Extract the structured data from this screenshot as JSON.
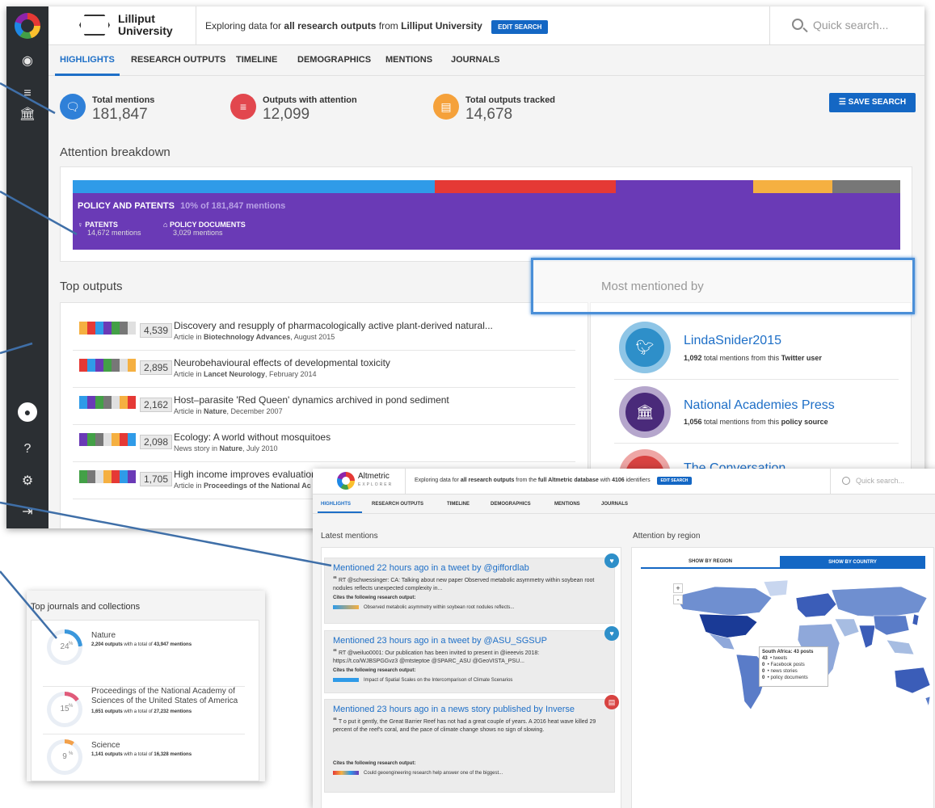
{
  "main": {
    "institution_line1": "Lilliput",
    "institution_line2": "University",
    "explore_pre": "Exploring data for ",
    "explore_bold1": "all research outputs",
    "explore_mid": " from ",
    "explore_bold2": "Lilliput University",
    "edit_search": "EDIT SEARCH",
    "quick_search_placeholder": "Quick search...",
    "tabs": [
      "HIGHLIGHTS",
      "RESEARCH OUTPUTS",
      "TIMELINE",
      "DEMOGRAPHICS",
      "MENTIONS",
      "JOURNALS"
    ],
    "stats": [
      {
        "label": "Total mentions",
        "value": "181,847",
        "color": "#2f80d8",
        "icon": "speech-bubbles-icon"
      },
      {
        "label": "Outputs with attention",
        "value": "12,099",
        "color": "#e2474e",
        "icon": "chat-icon"
      },
      {
        "label": "Total outputs tracked",
        "value": "14,678",
        "color": "#f5a13a",
        "icon": "document-icon"
      }
    ],
    "save_search": "SAVE SEARCH",
    "attention_heading": "Attention breakdown",
    "breakdown_colors": [
      "#2f9be8",
      "#e53935",
      "#6a3ab6",
      "#f5b041",
      "#777777"
    ],
    "policy_title": "POLICY AND PATENTS",
    "policy_sub": "10% of 181,847 mentions",
    "patents_label": "PATENTS",
    "patents_count": "14,672 mentions",
    "policy_docs_label": "POLICY DOCUMENTS",
    "policy_docs_count": "3,029 mentions",
    "top_outputs_heading": "Top outputs",
    "outputs": [
      {
        "score": "4,539",
        "title": "Discovery and resupply of pharmacologically active plant-derived natural...",
        "pre": "Article in ",
        "bold": "Biotechnology Advances",
        "post": ", August 2015"
      },
      {
        "score": "2,895",
        "title": "Neurobehavioural effects of developmental toxicity",
        "pre": "Article in ",
        "bold": "Lancet Neurology",
        "post": ", February 2014"
      },
      {
        "score": "2,162",
        "title": "Host–parasite 'Red Queen' dynamics archived in pond sediment",
        "pre": "Article in ",
        "bold": "Nature",
        "post": ", December 2007"
      },
      {
        "score": "2,098",
        "title": "Ecology: A world without mosquitoes",
        "pre": "News story in ",
        "bold": "Nature",
        "post": ", July 2010"
      },
      {
        "score": "1,705",
        "title": "High income improves evaluation of l",
        "pre": "Article in ",
        "bold": "Proceedings of the National Ac",
        "post": ""
      }
    ],
    "most_mentioned_heading": "Most mentioned by",
    "mentioners": [
      {
        "name": "LindaSnider2015",
        "count": "1,092",
        "mid": " total mentions from this ",
        "kind": "Twitter user",
        "color": "#2e8fc9"
      },
      {
        "name": "National Academies Press",
        "count": "1,056",
        "mid": " total mentions from this ",
        "kind": "policy source",
        "color": "#4a2a7a"
      },
      {
        "name": "The Conversation",
        "count": "",
        "mid": "",
        "kind": "",
        "color": "#d84341"
      }
    ]
  },
  "journals": {
    "heading": "Top journals and collections",
    "items": [
      {
        "pct": "24",
        "name": "Nature",
        "outputs": "2,204 outputs",
        "mid": " with a total of ",
        "mentions": "43,947 mentions",
        "color": "#3a97dc",
        "fill": 0.24
      },
      {
        "pct": "15",
        "name": "Proceedings of the National Academy of Sciences of the United States of America",
        "outputs": "1,651 outputs",
        "mid": " with a total of ",
        "mentions": "27,232 mentions",
        "color": "#e05b7a",
        "fill": 0.15
      },
      {
        "pct": "9",
        "name": "Science",
        "outputs": "1,141 outputs",
        "mid": " with a total of ",
        "mentions": "16,328 mentions",
        "color": "#f2a04a",
        "fill": 0.09
      }
    ]
  },
  "altmetric": {
    "brand": "Altmetric",
    "brand_sub": "EXPLORER",
    "explore_pre": "Exploring data for ",
    "explore_bold1": "all research outputs",
    "explore_mid": " from the ",
    "explore_bold2": "full Altmetric database",
    "explore_mid2": " with ",
    "explore_bold3": "4106",
    "explore_post": " identifiers",
    "edit_search": "EDIT SEARCH",
    "quick_search_placeholder": "Quick search...",
    "tabs": [
      "HIGHLIGHTS",
      "RESEARCH OUTPUTS",
      "TIMELINE",
      "DEMOGRAPHICS",
      "MENTIONS",
      "JOURNALS"
    ],
    "latest_heading": "Latest mentions",
    "region_heading": "Attention by region",
    "region_btn": "SHOW BY REGION",
    "country_btn": "SHOW BY COUNTRY",
    "mentions": [
      {
        "title": "Mentioned 22 hours ago in a tweet by @giffordlab",
        "quote": "RT @schwessinger: CA: Talking about new paper Observed metabolic asymmetry within soybean root nodules reflects unexpected complexity in...",
        "cites": "Cites the following research output:",
        "output": "Observed metabolic asymmetry within soybean root nodules reflects...",
        "badge_color": "#2e8fc9"
      },
      {
        "title": "Mentioned 23 hours ago in a tweet by @ASU_SGSUP",
        "quote": "RT @weiluo0001: Our publication has been invited to present in @ieeevis 2018: https://t.co/WJBSPGGvz3 @mtsteptoe @SPARC_ASU @GeoVISTA_PSU...",
        "cites": "Cites the following research output:",
        "output": "Impact of Spatial Scales on the Intercomparison of Climate Scenarios",
        "badge_color": "#2e8fc9"
      },
      {
        "title": "Mentioned 23 hours ago in a news story published by Inverse",
        "quote": "T o put it gently, the Great Barrier Reef has not had a great couple of years. A 2016 heat wave killed 29 percent of the reef's coral, and the pace of climate change shows no sign of slowing.",
        "cites": "Cites the following research output:",
        "output": "Could geoengineering research help answer one of the biggest...",
        "badge_color": "#d84341"
      }
    ],
    "tooltip_title": "South Africa: 43 posts",
    "tooltip_rows": [
      {
        "n": "43",
        "label": "tweets"
      },
      {
        "n": "0",
        "label": "Facebook posts"
      },
      {
        "n": "0",
        "label": "news stories"
      },
      {
        "n": "0",
        "label": "policy documents"
      }
    ],
    "zoom_in": "+",
    "zoom_out": "-"
  }
}
